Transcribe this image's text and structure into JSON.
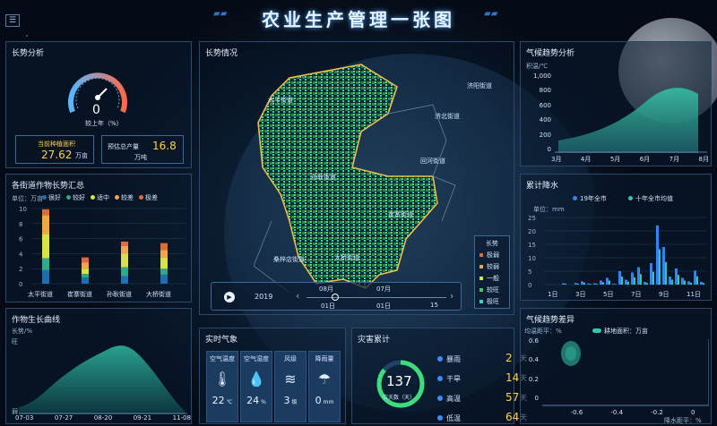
{
  "header": {
    "title": "农业生产管理一张图",
    "menu_icon": "☰"
  },
  "growth_analysis": {
    "title": "长势分析",
    "gauge_value": "0",
    "gauge_caption": "较上年（%）",
    "area_label": "当前种植面积",
    "area_value": "27.62",
    "area_unit": "万亩",
    "yield_label": "预估总产量",
    "yield_value": "16.8",
    "yield_unit": "万吨"
  },
  "crop_summary": {
    "title": "各街道作物长势汇总",
    "unit": "单位：万亩",
    "legend": [
      "很好",
      "较好",
      "适中",
      "较差",
      "极差"
    ],
    "legend_colors": [
      "#1e6fb0",
      "#2fa98c",
      "#d8e04a",
      "#f0a74a",
      "#e06b3a"
    ],
    "yticks": [
      "10",
      "8",
      "6",
      "4",
      "2",
      "0"
    ],
    "categories": [
      "太平街道",
      "崔寨街道",
      "孙耿街道",
      "大桥街道"
    ]
  },
  "growth_curve": {
    "title": "作物生长曲线",
    "ylabel": "长势/%",
    "ytick": "旺",
    "ytick2": "弱",
    "xticks": [
      "07-03",
      "07-27",
      "08-20",
      "09-21",
      "11-08"
    ]
  },
  "map": {
    "title": "长势情况",
    "places": [
      "太平街道",
      "济阳街道",
      "济北街道",
      "回河街道",
      "孙耿街道",
      "崔寨街道",
      "桑梓店街道",
      "大桥街道"
    ],
    "legend_title": "长势",
    "legend": [
      "极弱",
      "较弱",
      "一般",
      "较旺",
      "极旺"
    ],
    "legend_colors": [
      "#e06b3a",
      "#f0a74a",
      "#d8e04a",
      "#46c46e",
      "#2fd4c4"
    ],
    "timeline": {
      "year": "2019",
      "month_a": "08月",
      "day_a": "01日",
      "month_b": "07月",
      "day_b": "01日",
      "day_c": "15"
    }
  },
  "climate_trend": {
    "title": "气候趋势分析",
    "unit": "积温/℃",
    "yticks": [
      "1,000",
      "800",
      "600",
      "400",
      "200",
      "0"
    ],
    "xticks": [
      "3月",
      "4月",
      "5月",
      "6月",
      "7月",
      "8月"
    ]
  },
  "rainfall": {
    "title": "累计降水",
    "legend": [
      "19年全市",
      "十年全市均值"
    ],
    "unit": "单位：mm",
    "yticks": [
      "25",
      "20",
      "15",
      "10",
      "5",
      "0"
    ],
    "xticks": [
      "1日",
      "3日",
      "5日",
      "7日",
      "9日",
      "11日"
    ]
  },
  "anomaly": {
    "title": "气候趋势差异",
    "ylabel": "均温距平：%",
    "legend": "耕地面积：万亩",
    "yticks": [
      "0.6",
      "0.4",
      "0.2",
      "0"
    ],
    "xticks": [
      "-0.6",
      "-0.4",
      "-0.2",
      "0"
    ],
    "xlabel": "降水距平：%"
  },
  "weather": {
    "title": "实时气象",
    "cards": [
      {
        "label": "空气温度",
        "icon": "🌡",
        "value": "22",
        "unit": "℃"
      },
      {
        "label": "空气湿度",
        "icon": "💧",
        "value": "24",
        "unit": "%"
      },
      {
        "label": "风级",
        "icon": "≋",
        "value": "3",
        "unit": "级"
      },
      {
        "label": "降雨量",
        "icon": "☂",
        "value": "0",
        "unit": "mm"
      }
    ]
  },
  "disaster": {
    "title": "灾害累计",
    "ring_value": "137",
    "ring_caption": "灾天数（天）",
    "items": [
      {
        "name": "暴雨",
        "value": "2",
        "unit": "天"
      },
      {
        "name": "干旱",
        "value": "14",
        "unit": "天"
      },
      {
        "name": "高温",
        "value": "57",
        "unit": "天"
      },
      {
        "name": "低温",
        "value": "64",
        "unit": "天"
      }
    ]
  }
}
